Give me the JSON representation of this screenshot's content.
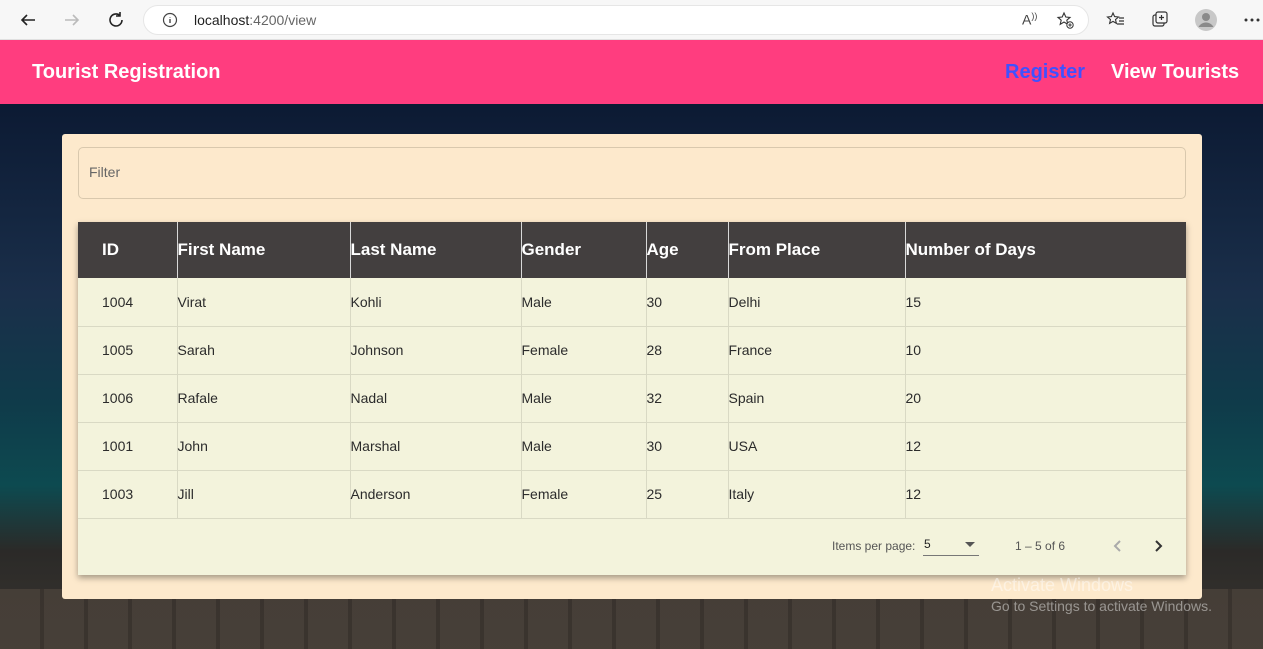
{
  "browser": {
    "url_host": "localhost",
    "url_path": ":4200/view"
  },
  "toolbar": {
    "title": "Tourist Registration",
    "nav": {
      "register": "Register",
      "view_tourists": "View Tourists"
    }
  },
  "filter": {
    "placeholder": "Filter",
    "value": ""
  },
  "table": {
    "columns": [
      "ID",
      "First Name",
      "Last Name",
      "Gender",
      "Age",
      "From Place",
      "Number of Days"
    ],
    "rows": [
      [
        "1004",
        "Virat",
        "Kohli",
        "Male",
        "30",
        "Delhi",
        "15"
      ],
      [
        "1005",
        "Sarah",
        "Johnson",
        "Female",
        "28",
        "France",
        "10"
      ],
      [
        "1006",
        "Rafale",
        "Nadal",
        "Male",
        "32",
        "Spain",
        "20"
      ],
      [
        "1001",
        "John",
        "Marshal",
        "Male",
        "30",
        "USA",
        "12"
      ],
      [
        "1003",
        "Jill",
        "Anderson",
        "Female",
        "25",
        "Italy",
        "12"
      ]
    ]
  },
  "paginator": {
    "items_per_page_label": "Items per page:",
    "items_per_page_value": "5",
    "range_label": "1 – 5 of 6"
  },
  "watermark": {
    "line1": "Activate Windows",
    "line2": "Go to Settings to activate Windows."
  },
  "colors": {
    "toolbar_bg": "#ff3d7f",
    "register_link": "#3f51ff",
    "card_bg": "#fde9cc",
    "table_header_bg": "#433f3f",
    "table_body_bg": "#f3f3dc"
  }
}
